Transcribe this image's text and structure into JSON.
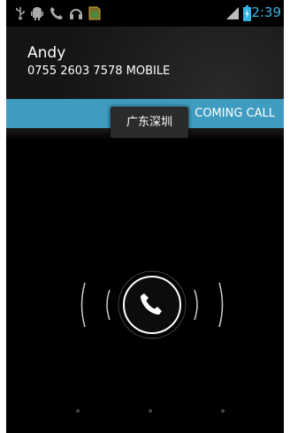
{
  "status_bar": {
    "icons_left": [
      "usb-icon",
      "android-debug-icon",
      "phone-call-icon",
      "headset-icon",
      "sim-icon"
    ],
    "icons_right": [
      "signal-icon",
      "battery-icon"
    ],
    "time": "2:39",
    "accent_color": "#33b5e5"
  },
  "caller": {
    "name": "Andy",
    "number_line": "0755 2603 7578  MOBILE"
  },
  "call_band": {
    "label": "COMING CALL",
    "color": "#3f9bbf"
  },
  "toast": {
    "location": "广东深圳"
  },
  "answer_widget": {
    "center_icon": "phone-handset-icon",
    "targets": [
      "hint-dot-left",
      "hint-dot-center",
      "hint-dot-right"
    ]
  }
}
